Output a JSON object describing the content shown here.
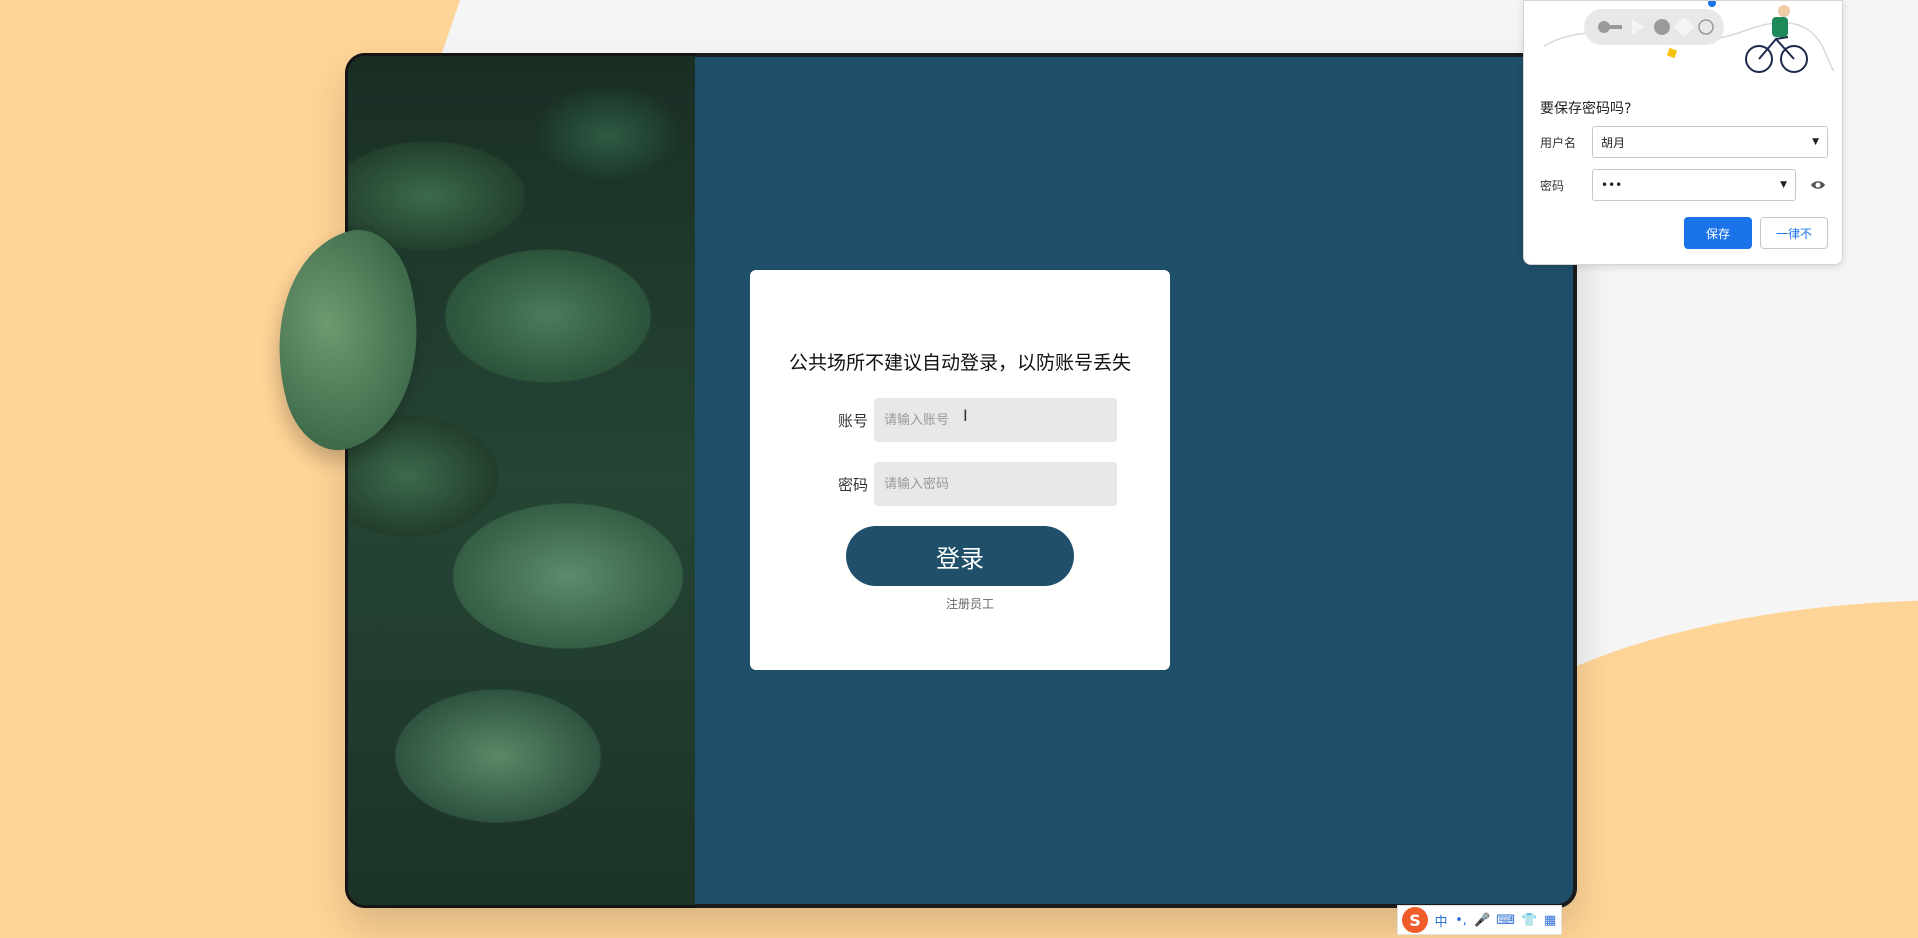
{
  "login": {
    "title": "公共场所不建议自动登录，以防账号丢失",
    "account_label": "账号",
    "account_placeholder": "请输入账号",
    "password_label": "密码",
    "password_placeholder": "请输入密码",
    "login_button": "登录",
    "register_link": "注册员工"
  },
  "save_password_popup": {
    "title": "要保存密码吗?",
    "username_label": "用户名",
    "username_value": "胡月",
    "password_label": "密码",
    "password_value": "•••",
    "save_button": "保存",
    "never_button": "一律不"
  },
  "ime_toolbar": {
    "logo": "S",
    "items": [
      "中",
      "•,",
      "🎤",
      "⌨",
      "👕",
      "▦"
    ]
  },
  "colors": {
    "background": "#ffd497",
    "card_panel": "#1f4f69",
    "login_button": "#1f4f69",
    "save_button": "#1a73e8"
  },
  "icons": {
    "cursor": "text-cursor-icon",
    "eye": "eye-icon",
    "key": "key-icon"
  }
}
